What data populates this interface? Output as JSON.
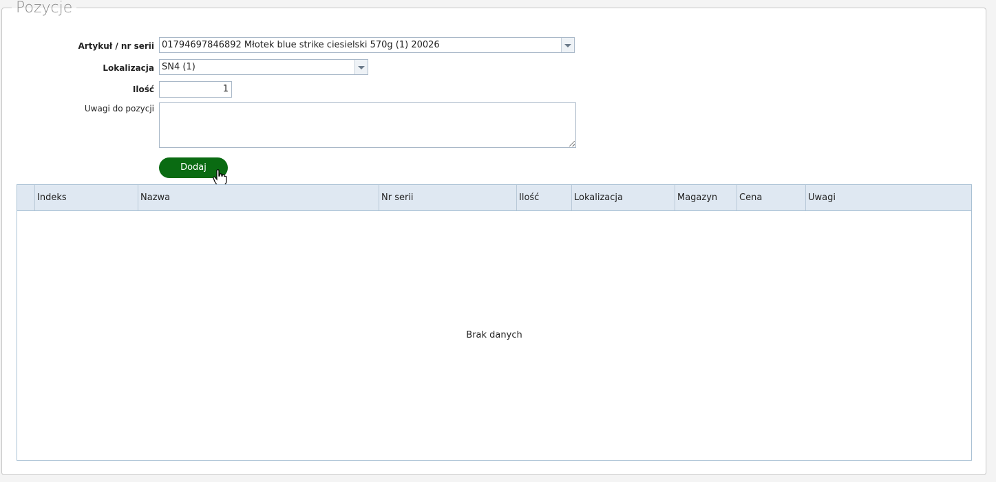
{
  "section": {
    "title": "Pozycje"
  },
  "form": {
    "article_label": "Artykuł / nr serii",
    "article_value": "01794697846892 Młotek blue strike ciesielski 570g (1) 20026",
    "location_label": "Lokalizacja",
    "location_value": "SN4 (1)",
    "quantity_label": "Ilość",
    "quantity_value": "1",
    "notes_label": "Uwagi do pozycji",
    "notes_value": "",
    "add_button": "Dodaj"
  },
  "grid": {
    "columns": [
      "",
      "Indeks",
      "Nazwa",
      "Nr serii",
      "Ilość",
      "Lokalizacja",
      "Magazyn",
      "Cena",
      "Uwagi"
    ],
    "empty_text": "Brak danych"
  },
  "colors": {
    "button": "#0a6b12",
    "grid_header": "#dfe8f2"
  }
}
